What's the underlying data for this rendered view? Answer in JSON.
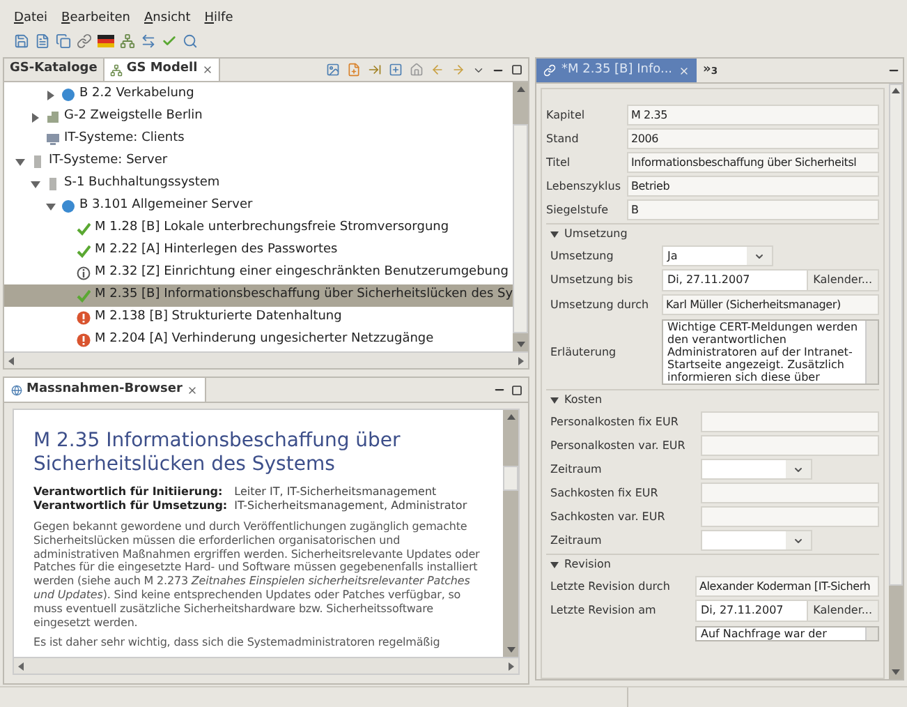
{
  "menu": [
    "Datei",
    "Bearbeiten",
    "Ansicht",
    "Hilfe"
  ],
  "model_panel": {
    "tabs": [
      {
        "label": "GS-Kataloge",
        "selected": false,
        "kind": "catalog"
      },
      {
        "label": "GS Modell",
        "selected": true,
        "kind": "model"
      }
    ],
    "tree": [
      {
        "children": [
          {
            "children": [
              {
                "label": "B 2.2 Verkabelung",
                "kind": "module",
                "expanded": false,
                "selected": false
              }
            ]
          },
          {
            "label": "G-2 Zweigstelle Berlin",
            "kind": "location",
            "expanded": false,
            "selected": false
          },
          {
            "label": "IT-Systeme: Clients",
            "kind": "clients",
            "selected": false
          }
        ]
      },
      {
        "label": "IT-Systeme: Server",
        "kind": "server",
        "expanded": true,
        "selected": false,
        "children": [
          {
            "label": "S-1 Buchhaltungssystem",
            "kind": "server",
            "expanded": true,
            "selected": false,
            "children": [
              {
                "label": "B 3.101 Allgemeiner Server",
                "kind": "module",
                "expanded": true,
                "selected": false,
                "children": [
                  {
                    "label": "M 1.28 [B] Lokale unterbrechungsfreie Stromversorgung",
                    "kind": "check",
                    "selected": false
                  },
                  {
                    "label": "M 2.22 [A] Hinterlegen des Passwortes",
                    "kind": "check",
                    "selected": false
                  },
                  {
                    "label": "M 2.32 [Z] Einrichtung einer eingeschränkten Benutzerumgebung",
                    "kind": "info",
                    "selected": false
                  },
                  {
                    "label": "M 2.35 [B] Informationsbeschaffung über Sicherheitslücken des Sy",
                    "kind": "check",
                    "selected": true
                  },
                  {
                    "label": "M 2.138 [B] Strukturierte Datenhaltung",
                    "kind": "warning",
                    "selected": false
                  },
                  {
                    "label": "M 2.204 [A] Verhinderung ungesicherter Netzzugänge",
                    "kind": "warning",
                    "selected": false
                  }
                ]
              }
            ]
          }
        ]
      }
    ]
  },
  "browser_panel": {
    "tab": "Massnahmen-Browser",
    "title": "M 2.35 Informationsbeschaffung über Sicherheitslücken des Systems",
    "responsibilities": [
      {
        "label": "Verantwortlich für Initiierung:",
        "value": "Leiter IT, IT-Sicherheitsmanagement"
      },
      {
        "label": "Verantwortlich für Umsetzung:",
        "value": "IT-Sicherheitsmanagement, Administrator"
      }
    ],
    "paragraphs": [
      "Gegen bekannt gewordene und durch Veröffentlichungen zugänglich gemachte Sicherheitslücken müssen die erforderlichen organisatorischen und administrativen Maßnahmen ergriffen werden. Sicherheitsrelevante Updates oder Patches für die eingesetzte Hard- und Software müssen gegebenenfalls installiert werden (siehe auch M 2.273 *Zeitnahes Einspielen sicherheitsrelevanter Patches und Updates*). Sind keine entsprechenden Updates oder Patches verfügbar, so muss eventuell zusätzliche Sicherheitshardware bzw. Sicherheitssoftware eingesetzt werden.",
      "Es ist daher sehr wichtig, dass sich die Systemadministratoren regelmäßig"
    ]
  },
  "editor": {
    "tabs": [
      {
        "label": "*M 2.35 [B] Info...",
        "selected": true
      },
      {
        "label": "»$_{3}$",
        "selected": false
      }
    ],
    "sections": [
      {
        "fields": [
          {
            "kind": "text",
            "label": "Kapitel",
            "value": "M 2.35"
          },
          {
            "kind": "text",
            "label": "Stand",
            "value": "2006"
          },
          {
            "kind": "text",
            "label": "Titel",
            "value": "Informationsbeschaffung über Sicherheitsl"
          },
          {
            "kind": "text",
            "label": "Lebenszyklus",
            "value": "Betrieb"
          },
          {
            "kind": "text",
            "label": "Siegelstufe",
            "value": "B"
          }
        ]
      },
      {
        "title": "Umsetzung",
        "expanded": true,
        "fields": [
          {
            "kind": "combo",
            "label": "Umsetzung",
            "value": "Ja"
          },
          {
            "kind": "date",
            "label": "Umsetzung bis",
            "value": "Di, 27.11.2007",
            "button": "Kalender..."
          },
          {
            "kind": "text",
            "label": "Umsetzung durch",
            "value": "Karl Müller (Sicherheitsmanager)"
          },
          {
            "kind": "textarea",
            "label": "Erläuterung",
            "value": "Wichtige CERT-Meldungen werden den verantwortlichen Administratoren auf der Intranet-Startseite angezeigt. Zusätzlich informieren sich diese über"
          }
        ]
      },
      {
        "title": "Kosten",
        "expanded": true,
        "fields": [
          {
            "kind": "text",
            "label": "Personalkosten fix EUR"
          },
          {
            "kind": "text",
            "label": "Personalkosten var. EUR"
          },
          {
            "kind": "combo",
            "label": "Zeitraum"
          },
          {
            "kind": "text",
            "label": "Sachkosten fix EUR"
          },
          {
            "kind": "text",
            "label": "Sachkosten var. EUR"
          },
          {
            "kind": "combo",
            "label": "Zeitraum"
          }
        ]
      },
      {
        "title": "Revision",
        "expanded": true,
        "fields": [
          {
            "kind": "text",
            "label": "Letzte Revision durch",
            "value": "Alexander Koderman [IT-Sicherh"
          },
          {
            "kind": "date",
            "label": "Letzte Revision am",
            "value": "Di, 27.11.2007",
            "button": "Kalender..."
          },
          {
            "kind": "textarea",
            "value": "Auf Nachfrage war der"
          }
        ]
      }
    ]
  }
}
